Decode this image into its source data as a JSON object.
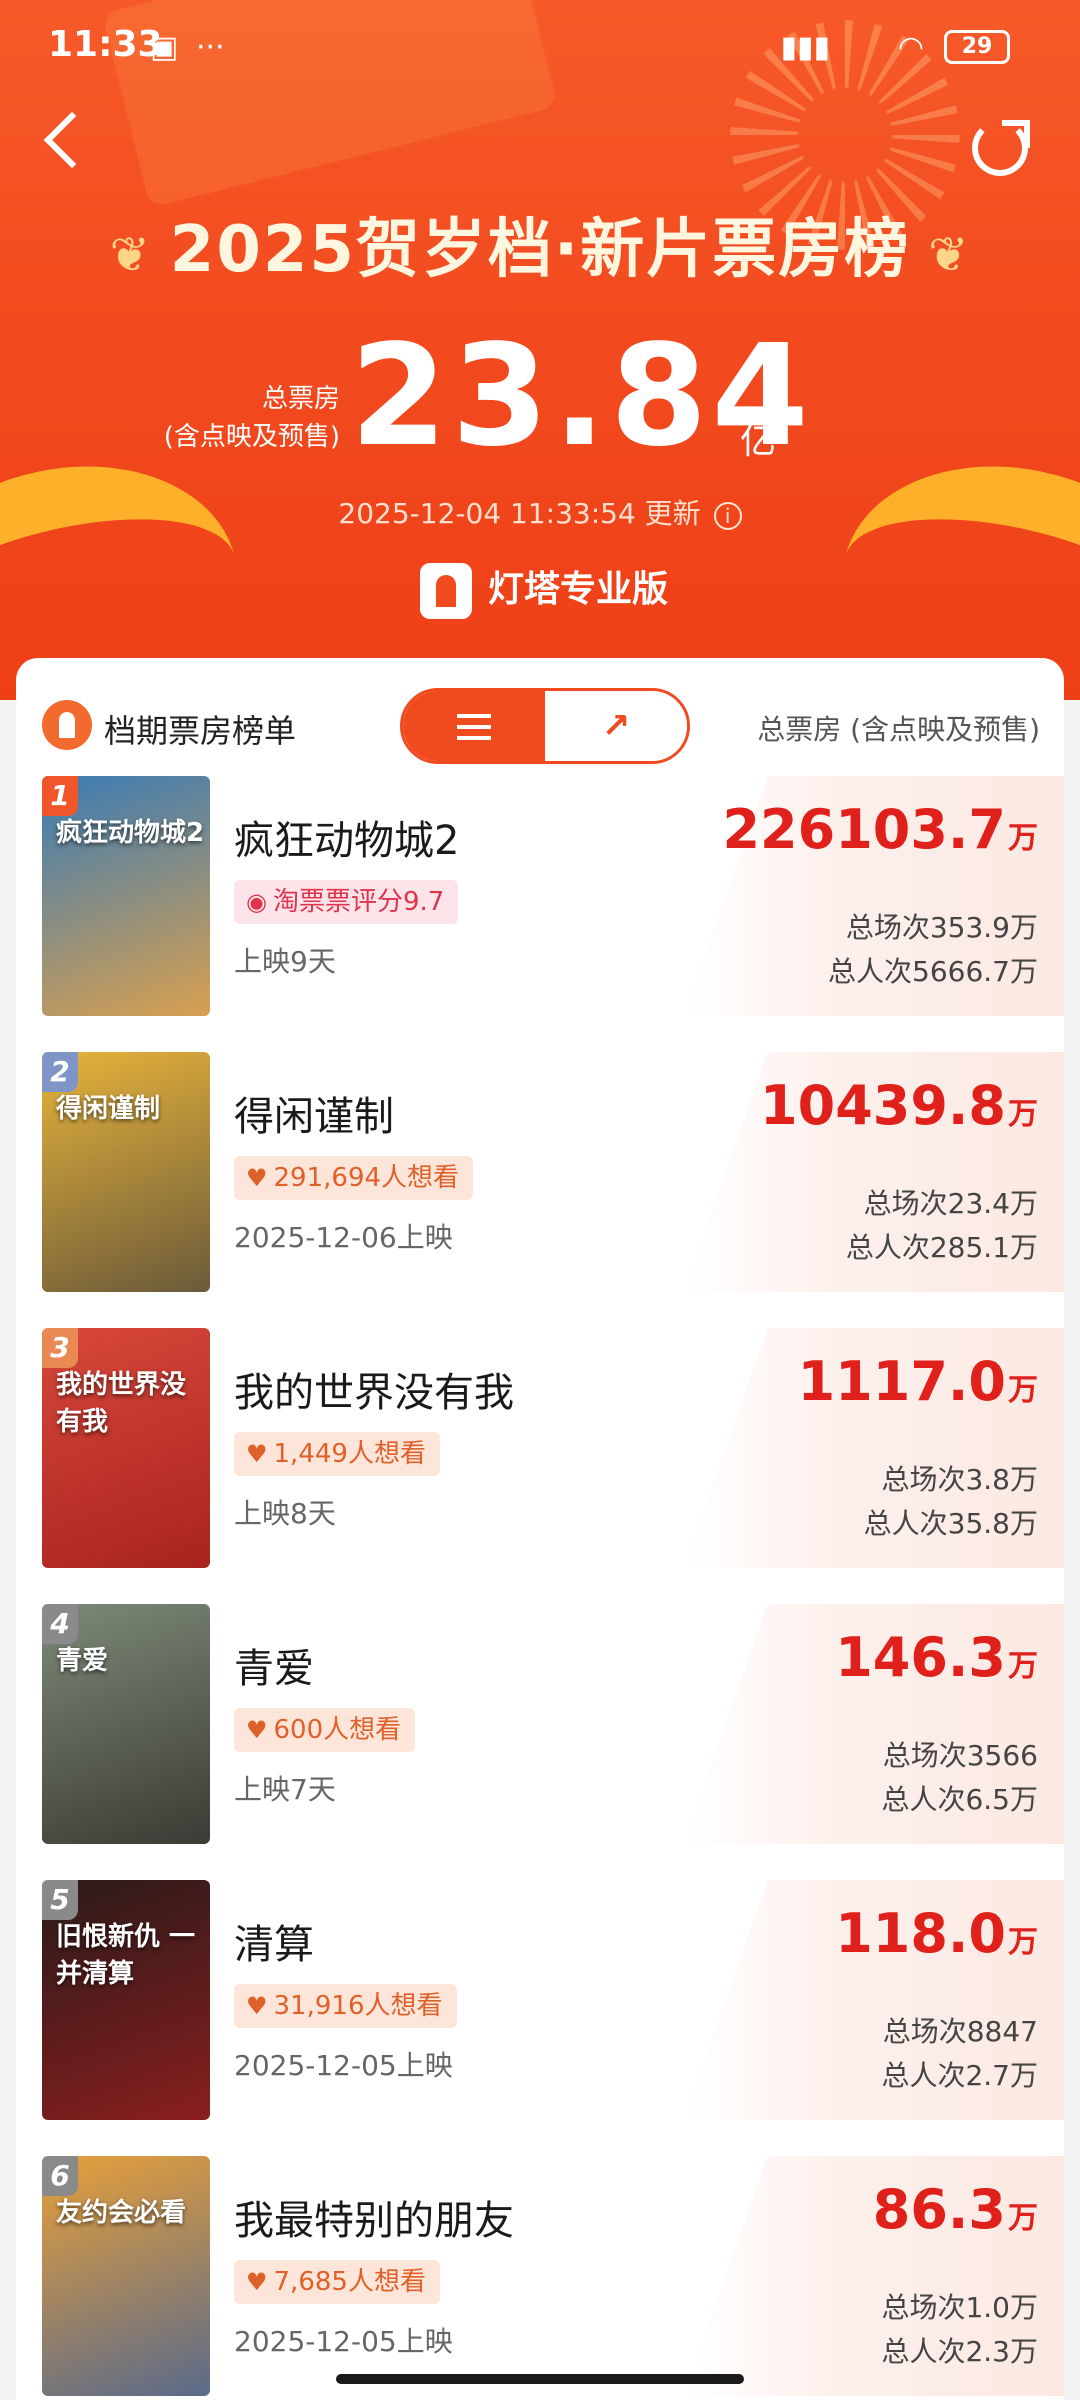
{
  "status_bar": {
    "time": "11:33",
    "battery": "29"
  },
  "header": {
    "title": "2025贺岁档·新片票房榜",
    "total_label_line1": "总票房",
    "total_label_line2": "(含点映及预售)",
    "total_value": "23.84",
    "total_unit": "亿",
    "updated": "2025-12-04 11:33:54 更新",
    "brand": "灯塔专业版"
  },
  "card": {
    "title": "档期票房榜单",
    "right_label": "总票房 (含点映及预售)",
    "unit": "万",
    "rows": [
      {
        "rank": "1",
        "name": "疯狂动物城2",
        "tag": "淘票票评分9.7",
        "tag_type": "rating",
        "sub": "上映9天",
        "box": "226103.7",
        "stat1": "总场次353.9万",
        "stat2": "总人次5666.7万",
        "poster_text": "疯狂动物城2",
        "poster_colors": [
          "#3a7bb5",
          "#d8a050"
        ]
      },
      {
        "rank": "2",
        "name": "得闲谨制",
        "tag": "291,694人想看",
        "tag_type": "want",
        "sub": "2025-12-06上映",
        "box": "10439.8",
        "stat1": "总场次23.4万",
        "stat2": "总人次285.1万",
        "poster_text": "得闲谨制",
        "poster_colors": [
          "#e7b33a",
          "#6b5a3a"
        ]
      },
      {
        "rank": "3",
        "name": "我的世界没有我",
        "tag": "1,449人想看",
        "tag_type": "want",
        "sub": "上映8天",
        "box": "1117.0",
        "stat1": "总场次3.8万",
        "stat2": "总人次35.8万",
        "poster_text": "我的世界没有我",
        "poster_colors": [
          "#d8473a",
          "#a8231e"
        ]
      },
      {
        "rank": "4",
        "name": "青爱",
        "tag": "600人想看",
        "tag_type": "want",
        "sub": "上映7天",
        "box": "146.3",
        "stat1": "总场次3566",
        "stat2": "总人次6.5万",
        "poster_text": "青爱",
        "poster_colors": [
          "#7c8a78",
          "#3c3a34"
        ]
      },
      {
        "rank": "5",
        "name": "清算",
        "tag": "31,916人想看",
        "tag_type": "want",
        "sub": "2025-12-05上映",
        "box": "118.0",
        "stat1": "总场次8847",
        "stat2": "总人次2.7万",
        "poster_text": "旧恨新仇 一并清算",
        "poster_colors": [
          "#2a1a1a",
          "#8a1e1e"
        ]
      },
      {
        "rank": "6",
        "name": "我最特别的朋友",
        "tag": "7,685人想看",
        "tag_type": "want",
        "sub": "2025-12-05上映",
        "box": "86.3",
        "stat1": "总场次1.0万",
        "stat2": "总人次2.3万",
        "poster_text": "友约会必看",
        "poster_colors": [
          "#e8a03a",
          "#5a6a8a"
        ]
      }
    ]
  },
  "colors": {
    "accent": "#f04b1e",
    "box_red": "#e0201a",
    "rank_badges": [
      "#f1552a",
      "#7f95c8",
      "#e98a55",
      "#8a8a8a",
      "#8a8a8a",
      "#8a8a8a"
    ]
  }
}
